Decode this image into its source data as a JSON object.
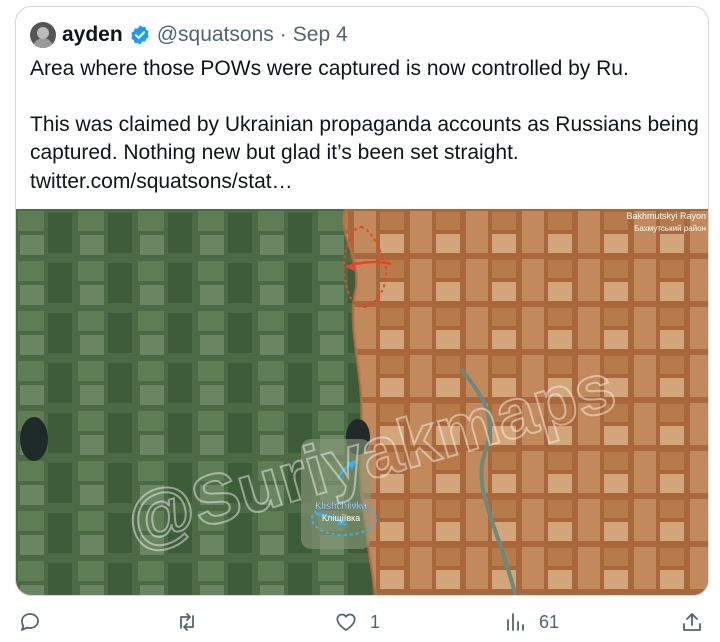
{
  "tweet": {
    "display_name": "ayden",
    "handle": "@squatsons",
    "separator": "·",
    "date": "Sep 4",
    "line1": "Area where those POWs were captured is now controlled by Ru.",
    "line2": "This was claimed by Ukrainian propaganda accounts as Russians being",
    "line3": "captured. Nothing new but glad it’s been set straight.",
    "link": "twitter.com/squatsons/stat…"
  },
  "map": {
    "watermark": "@Suriyakmaps",
    "village_label_en": "Klishchiivka",
    "village_label_uk": "Кліщіївка",
    "corner_label_en": "Bakhmutskyi Rayon",
    "corner_label_uk": "Бахмутський район",
    "colors": {
      "ukraine_controlled": "#3d5a3a",
      "russia_controlled": "#b06a3a",
      "arrow_red": "#e8442a",
      "arrow_blue": "#3ab0f0"
    }
  },
  "actions": {
    "reply_count": "",
    "retweet_count": "",
    "like_count": "1",
    "views_count": "61",
    "icons": [
      "reply-icon",
      "retweet-icon",
      "like-icon",
      "views-icon",
      "share-icon"
    ]
  }
}
